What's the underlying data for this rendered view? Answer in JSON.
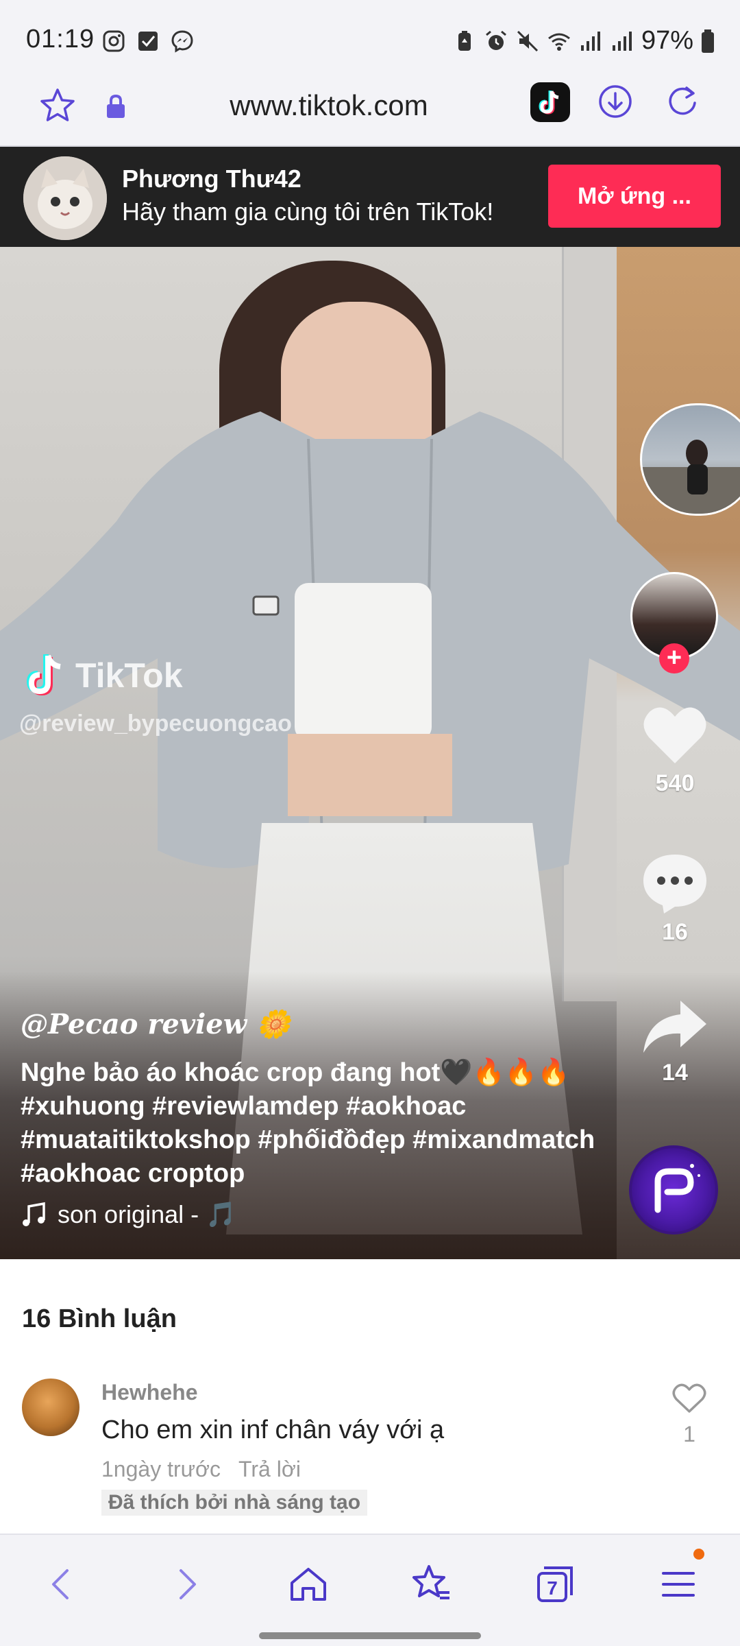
{
  "status_bar": {
    "time": "01:19",
    "battery": "97%",
    "app_icons": [
      "instagram-icon",
      "checkbox-icon",
      "messenger-icon"
    ],
    "system_icons": [
      "battery-saver-icon",
      "alarm-icon",
      "mute-icon",
      "wifi-icon",
      "signal-icon",
      "signal-icon"
    ]
  },
  "address_bar": {
    "url": "www.tiktok.com",
    "icons": [
      "star-icon",
      "lock-icon",
      "tiktok-app-icon",
      "download-icon",
      "reload-icon"
    ]
  },
  "banner": {
    "name": "Phương Thư42",
    "subtitle": "Hãy tham gia cùng tôi trên TikTok!",
    "open_button": "Mở ứng ..."
  },
  "video": {
    "watermark_brand": "TikTok",
    "watermark_user": "@review_bypecuongcao",
    "actions": {
      "likes": "540",
      "comments": "16",
      "shares": "14"
    },
    "caption_user": "@Pecao review 🌼",
    "caption_text": "Nghe bảo áo khoác crop đang hot🖤🔥🔥🔥 #xuhuong #reviewlamdep #aokhoac #muataitiktokshop #phốiđồđẹp #mixandmatch #aokhoac croptop",
    "music": "son original - 🎵"
  },
  "comments": {
    "title": "16 Bình luận",
    "items": [
      {
        "user": "Hewhehe",
        "text": "Cho em xin inf chân váy với ạ",
        "time": "1ngày trước",
        "reply_label": "Trả lời",
        "badge": "Đã thích bởi nhà sáng tạo",
        "likes": "1"
      }
    ]
  },
  "bottom_nav": {
    "icons": [
      "back-icon",
      "forward-icon",
      "home-icon",
      "bookmarks-icon",
      "tabs-icon",
      "menu-icon"
    ],
    "tabs_count": "7"
  },
  "colors": {
    "accent": "#5a46d6",
    "tiktok_red": "#fe2c55",
    "notification_dot": "#f06a0f"
  }
}
